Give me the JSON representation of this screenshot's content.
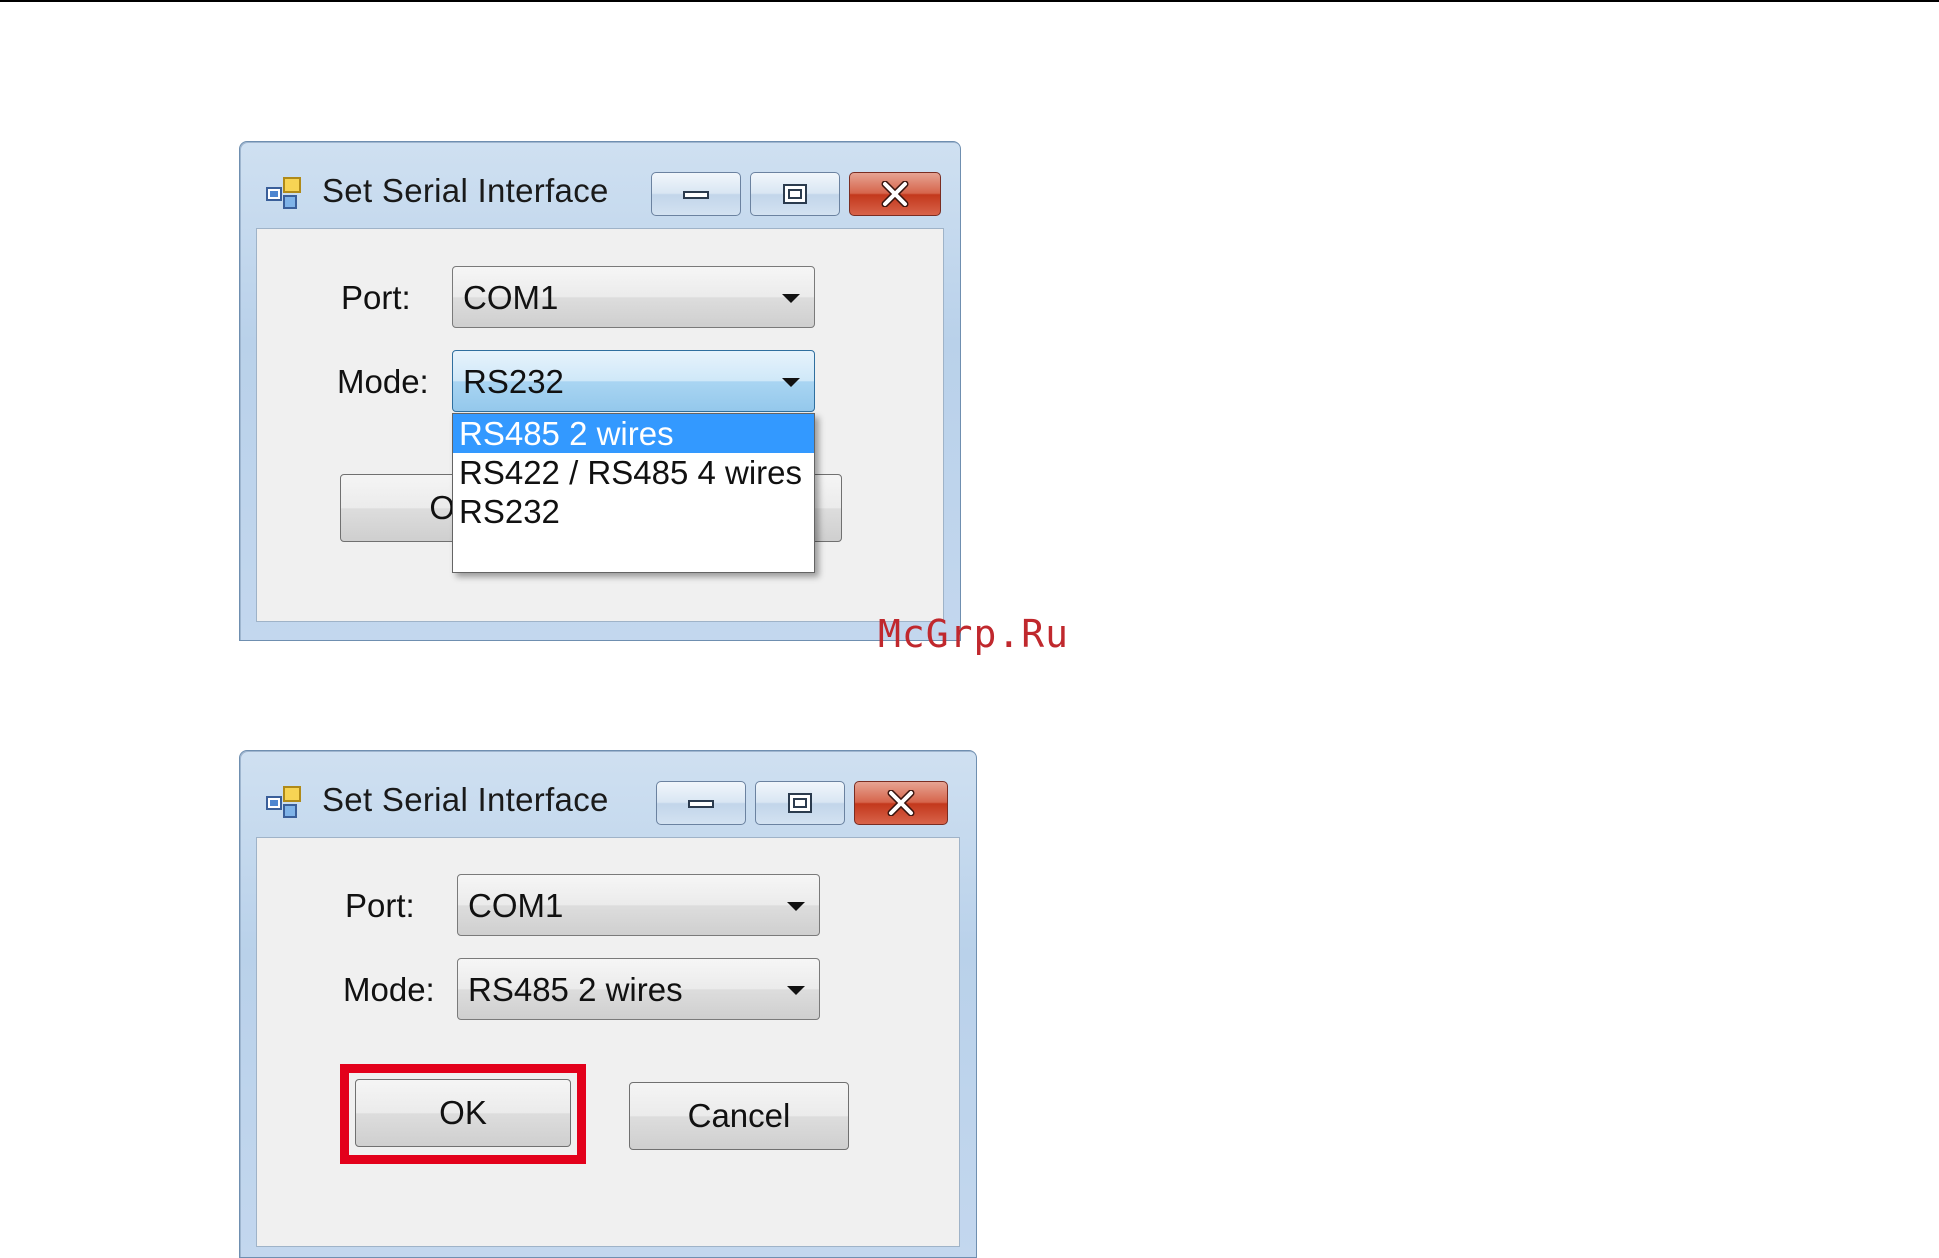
{
  "watermark": "McGrp.Ru",
  "dialog_open": {
    "title": "Set Serial Interface",
    "port_label": "Port:",
    "port_value": "COM1",
    "mode_label": "Mode:",
    "mode_value": "RS232",
    "ok_label_partial": "O",
    "dropdown_options": [
      "RS485 2 wires",
      "RS422 / RS485 4 wires",
      "RS232"
    ],
    "dropdown_selected": "RS485 2 wires"
  },
  "dialog_result": {
    "title": "Set Serial Interface",
    "port_label": "Port:",
    "port_value": "COM1",
    "mode_label": "Mode:",
    "mode_value": "RS485 2 wires",
    "ok_label": "OK",
    "cancel_label": "Cancel"
  },
  "colors": {
    "selection": "#3399ff",
    "highlight": "#e3001b",
    "watermark": "#c0282d"
  },
  "icons": {
    "app": "app-window-icon",
    "minimize": "minimize-icon",
    "maximize": "maximize-icon",
    "close": "close-icon",
    "dropdown": "chevron-down-icon"
  }
}
